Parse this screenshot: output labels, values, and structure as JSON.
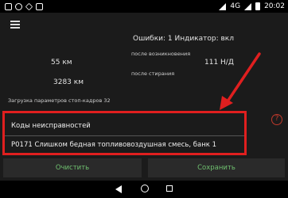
{
  "status_bar": {
    "time": "20:02",
    "network": "4G",
    "left_icons": [
      "notification-icon",
      "gear-icon",
      "play-icon",
      "shield-icon"
    ]
  },
  "header": {
    "errors_text": "Ошибки: 1 Индикатор: вкл"
  },
  "stats": {
    "after_occurrence_label": "после возникновения",
    "distance_after_occurrence": "55 км",
    "nd_value": "111 Н/Д",
    "after_clear_label": "после стирания",
    "distance_after_clear": "3283 км",
    "freeze_frame_text": "Загрузка параметров стоп-кадров 32"
  },
  "faults": {
    "title": "Коды неисправностей",
    "items": [
      {
        "text": "P0171 Слишком бедная топливовоздушная смесь, банк 1"
      }
    ]
  },
  "buttons": {
    "clear_label": "Очистить",
    "save_label": "Сохранить"
  },
  "colors": {
    "highlight": "#e01f1f",
    "button_text": "#6fbf6f",
    "help_icon": "#c0392b"
  }
}
